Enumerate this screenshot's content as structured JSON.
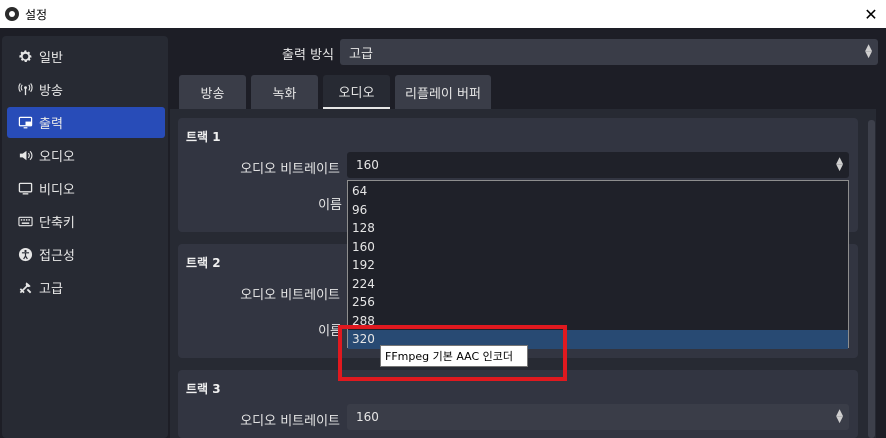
{
  "window": {
    "title": "설정",
    "close_glyph": "✕",
    "app_icon": "obs-logo-icon"
  },
  "sidebar": {
    "items": [
      {
        "label": "일반",
        "icon": "gear-icon",
        "active": false
      },
      {
        "label": "방송",
        "icon": "antenna-icon",
        "active": false
      },
      {
        "label": "출력",
        "icon": "output-monitor-icon",
        "active": true
      },
      {
        "label": "오디오",
        "icon": "speaker-icon",
        "active": false
      },
      {
        "label": "비디오",
        "icon": "monitor-icon",
        "active": false
      },
      {
        "label": "단축키",
        "icon": "keyboard-icon",
        "active": false
      },
      {
        "label": "접근성",
        "icon": "accessibility-icon",
        "active": false
      },
      {
        "label": "고급",
        "icon": "tools-icon",
        "active": false
      }
    ]
  },
  "output_mode": {
    "label": "출력 방식",
    "value": "고급"
  },
  "tabs": [
    {
      "label": "방송",
      "active": false
    },
    {
      "label": "녹화",
      "active": false
    },
    {
      "label": "오디오",
      "active": true
    },
    {
      "label": "리플레이 버퍼",
      "active": false
    }
  ],
  "tracks": [
    {
      "title": "트랙 1",
      "bitrate_label": "오디오 비트레이트",
      "bitrate_value": "160",
      "name_label": "이름"
    },
    {
      "title": "트랙 2",
      "bitrate_label": "오디오 비트레이트",
      "name_label": "이름"
    },
    {
      "title": "트랙 3",
      "bitrate_label": "오디오 비트레이트",
      "bitrate_value": "160"
    }
  ],
  "bitrate_dropdown": {
    "options": [
      "64",
      "96",
      "128",
      "160",
      "192",
      "224",
      "256",
      "288",
      "320"
    ],
    "highlighted": "320"
  },
  "tooltip": {
    "text": "FFmpeg 기본 AAC 인코더"
  },
  "colors": {
    "accent": "#284cb8",
    "highlight_box": "#e0191f",
    "dropdown_selected": "#284a73"
  }
}
